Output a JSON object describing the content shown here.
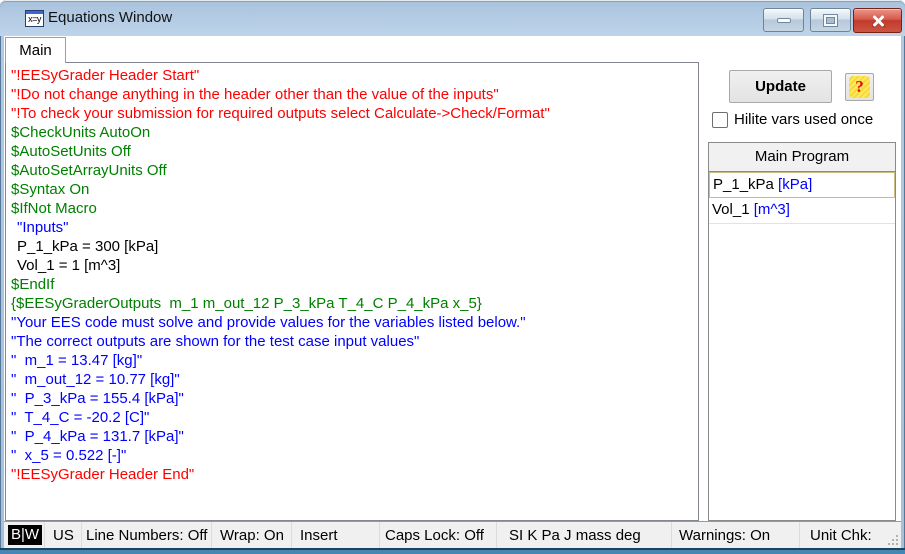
{
  "window": {
    "title": "Equations Window",
    "icon_text": "x=y"
  },
  "tabs": [
    {
      "label": "Main",
      "active": true
    }
  ],
  "editor": {
    "lines": [
      {
        "text": "\"!EESyGrader Header Start\"",
        "type": "comment",
        "indent": 0
      },
      {
        "text": "\"!Do not change anything in the header other than the value of the inputs\"",
        "type": "comment",
        "indent": 0
      },
      {
        "text": "\"!To check your submission for required outputs select Calculate->Check/Format\"",
        "type": "comment",
        "indent": 0
      },
      {
        "text": "$CheckUnits AutoOn",
        "type": "directive",
        "indent": 0
      },
      {
        "text": "$AutoSetUnits Off",
        "type": "directive",
        "indent": 0
      },
      {
        "text": "$AutoSetArrayUnits Off",
        "type": "directive",
        "indent": 0
      },
      {
        "text": "$Syntax On",
        "type": "directive",
        "indent": 0
      },
      {
        "text": "$IfNot Macro",
        "type": "directive",
        "indent": 0
      },
      {
        "text": "\"Inputs\"",
        "type": "string",
        "indent": 1
      },
      {
        "text": "P_1_kPa = 300 [kPa]",
        "type": "code",
        "indent": 1
      },
      {
        "text": "Vol_1 = 1 [m^3]",
        "type": "code",
        "indent": 1
      },
      {
        "text": "$EndIf",
        "type": "directive",
        "indent": 0
      },
      {
        "text": "{$EESyGraderOutputs  m_1 m_out_12 P_3_kPa T_4_C P_4_kPa x_5}",
        "type": "directive",
        "indent": 0
      },
      {
        "text": "\"Your EES code must solve and provide values for the variables listed below.\"",
        "type": "string",
        "indent": 0
      },
      {
        "text": "\"The correct outputs are shown for the test case input values\"",
        "type": "string",
        "indent": 0
      },
      {
        "text": "\"  m_1 = 13.47 [kg]\"",
        "type": "string",
        "indent": 0
      },
      {
        "text": "\"  m_out_12 = 10.77 [kg]\"",
        "type": "string",
        "indent": 0
      },
      {
        "text": "\"  P_3_kPa = 155.4 [kPa]\"",
        "type": "string",
        "indent": 0
      },
      {
        "text": "\"  T_4_C = -20.2 [C]\"",
        "type": "string",
        "indent": 0
      },
      {
        "text": "\"  P_4_kPa = 131.7 [kPa]\"",
        "type": "string",
        "indent": 0
      },
      {
        "text": "\"  x_5 = 0.522 [-]\"",
        "type": "string",
        "indent": 0
      },
      {
        "text": "\"!EESyGrader Header End\"",
        "type": "comment",
        "indent": 0
      }
    ]
  },
  "side_panel": {
    "update_button": "Update",
    "help_button": "?",
    "hilite_label": "Hilite vars used once",
    "hilite_checked": false,
    "program_panel": {
      "header": "Main Program",
      "variables": [
        {
          "name": "P_1_kPa",
          "unit": "[kPa]",
          "selected": true
        },
        {
          "name": "Vol_1",
          "unit": "[m^3]",
          "selected": false
        }
      ]
    }
  },
  "status_bar": [
    {
      "label": "B|W",
      "inverted": true
    },
    {
      "label": "US"
    },
    {
      "label": "Line Numbers: Off"
    },
    {
      "label": "Wrap: On"
    },
    {
      "label": "Insert"
    },
    {
      "label": "Caps Lock: Off"
    },
    {
      "label": "SI K Pa J mass deg"
    },
    {
      "label": "Warnings: On"
    },
    {
      "label": "Unit Chk:"
    }
  ],
  "colors": {
    "comment": "#ff0000",
    "directive": "#008000",
    "string": "#0000ff",
    "code": "#000000",
    "close_button": "#c23b2b",
    "help_badge": "#f5d93a",
    "help_question": "#dd1111",
    "selected_var_border": "#c9bc85"
  }
}
